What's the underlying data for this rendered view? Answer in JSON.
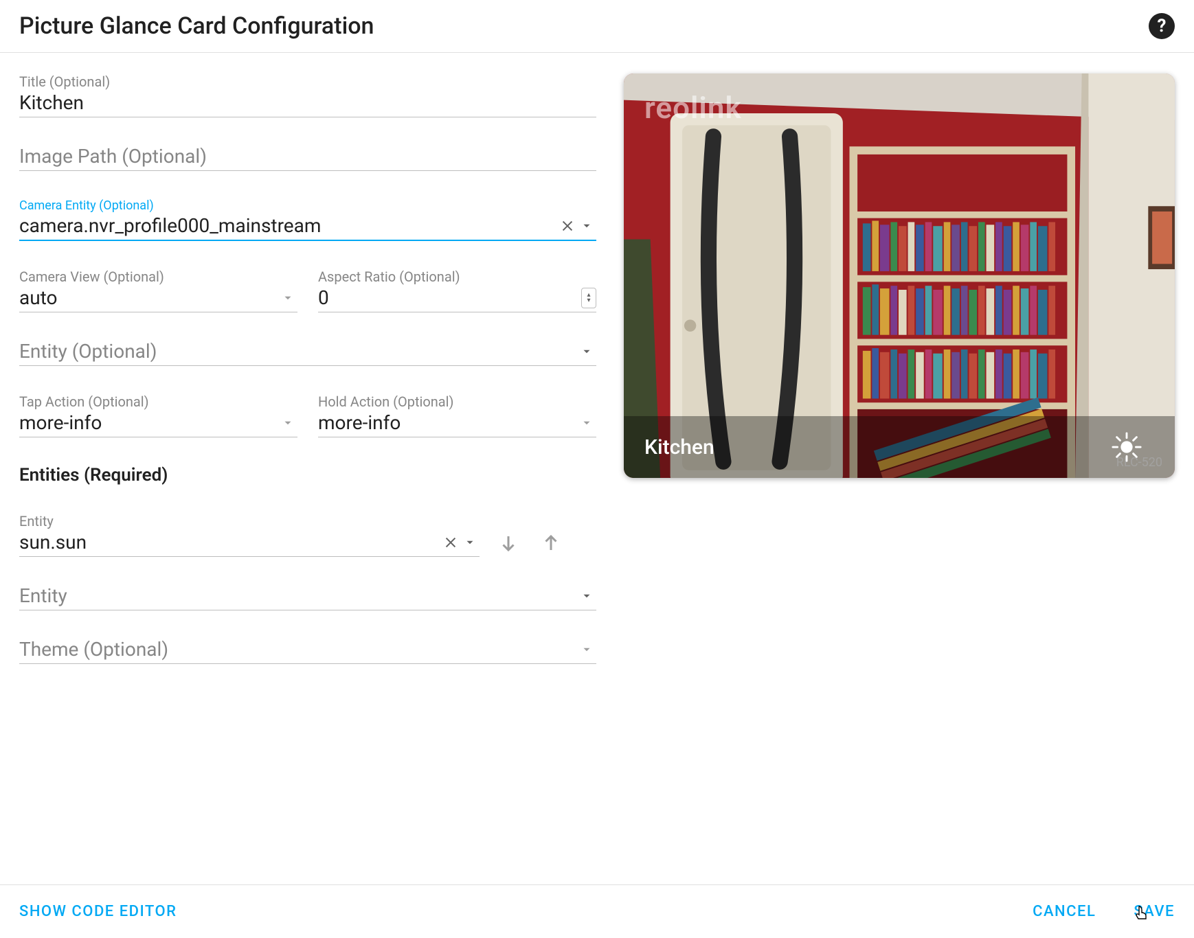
{
  "header": {
    "title": "Picture Glance Card Configuration"
  },
  "form": {
    "title_label": "Title (Optional)",
    "title_value": "Kitchen",
    "image_path_placeholder": "Image Path (Optional)",
    "camera_entity_label": "Camera Entity (Optional)",
    "camera_entity_value": "camera.nvr_profile000_mainstream",
    "camera_view_label": "Camera View (Optional)",
    "camera_view_value": "auto",
    "aspect_ratio_label": "Aspect Ratio (Optional)",
    "aspect_ratio_value": "0",
    "entity_placeholder": "Entity (Optional)",
    "tap_action_label": "Tap Action (Optional)",
    "tap_action_value": "more-info",
    "hold_action_label": "Hold Action (Optional)",
    "hold_action_value": "more-info",
    "entities_section": "Entities (Required)",
    "entity_item_label": "Entity",
    "entity_item_value": "sun.sun",
    "entity_add_placeholder": "Entity",
    "theme_placeholder": "Theme (Optional)"
  },
  "preview": {
    "watermark": "reolink",
    "overlay_title": "Kitchen",
    "model": "RLC-520"
  },
  "footer": {
    "show_code": "SHOW CODE EDITOR",
    "cancel": "CANCEL",
    "save": "SAVE"
  }
}
